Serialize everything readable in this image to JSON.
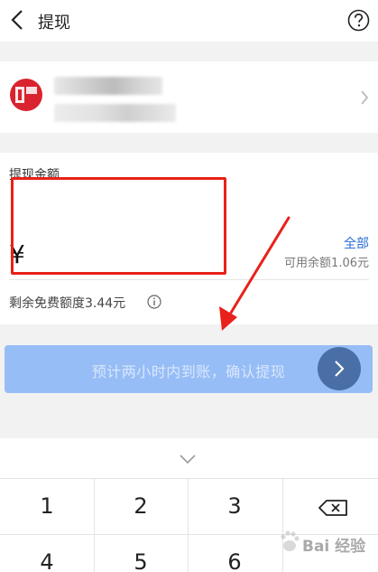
{
  "header": {
    "title": "提现",
    "help_icon": "question-circle-icon",
    "back_icon": "chevron-left-icon"
  },
  "bank_card": {
    "logo": "bank-logo",
    "chevron_icon": "chevron-right-icon"
  },
  "amount": {
    "label": "提现金额",
    "currency_symbol": "¥",
    "all_label": "全部",
    "balance_text": "可用余额1.06元",
    "free_quota_text": "剩余免费额度3.44元",
    "info_icon": "info-icon"
  },
  "confirm": {
    "label": "预计两小时内到账，确认提现",
    "go_icon": "chevron-right-circle-icon"
  },
  "keyboard": {
    "collapse_icon": "chevron-down-icon",
    "keys": [
      "1",
      "2",
      "3",
      "4",
      "5",
      "6"
    ],
    "delete_icon": "backspace-icon"
  },
  "watermark": {
    "text": "Bai 经验"
  },
  "colors": {
    "accent": "#2a6fd4",
    "button": "#97bdf6",
    "highlight_box": "#e8211a"
  }
}
